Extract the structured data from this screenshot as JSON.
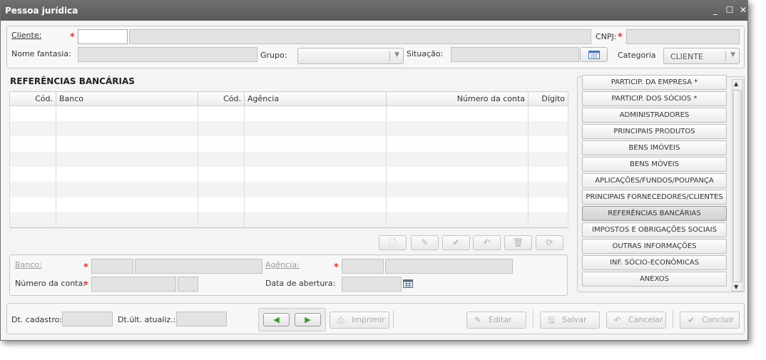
{
  "window": {
    "title": "Pessoa jurídica",
    "minimize": "_",
    "maximize": "☐",
    "close": "✕"
  },
  "header": {
    "cliente_label": "Cliente:",
    "cnpj_label": "CNPJ:",
    "nome_fantasia_label": "Nome fantasia:",
    "grupo_label": "Grupo:",
    "situacao_label": "Situação:",
    "categoria_label": "Categoria",
    "categoria_value": "CLIENTE",
    "required_mark": "*"
  },
  "section": {
    "title": "REFERÊNCIAS BANCÁRIAS",
    "columns": [
      "Cód.",
      "Banco",
      "Cód.",
      "Agência",
      "Número da conta",
      "Dígito"
    ]
  },
  "detail": {
    "banco_label": "Banco:",
    "agencia_label": "Agência:",
    "numero_conta_label": "Número da conta:",
    "data_abertura_label": "Data de abertura:"
  },
  "side_menu": [
    "PARTICIP. DA EMPRESA *",
    "PARTICIP. DOS SÓCIOS *",
    "ADMINISTRADORES",
    "PRINCIPAIS PRODUTOS",
    "BENS IMÓVEIS",
    "BENS MÓVEIS",
    "APLICAÇÕES/FUNDOS/POUPANÇA",
    "PRINCIPAIS FORNECEDORES/CLIENTES",
    "REFERÊNCIAS BANCÁRIAS",
    "IMPOSTOS E OBRIGAÇÕES SOCIAIS",
    "OUTRAS INFORMAÇÕES",
    "INF. SÓCIO-ECONÔMICAS",
    "ANEXOS"
  ],
  "side_menu_active": "REFERÊNCIAS BANCÁRIAS",
  "footer": {
    "dt_cadastro_label": "Dt. cadastro:",
    "dt_ult_atualiz_label": "Dt.últ. atualiz.:",
    "imprimir": "Imprimir",
    "editar": "Editar",
    "salvar": "Salvar",
    "cancelar": "Cancelar",
    "concluir": "Concluir"
  },
  "colors": {
    "titlebar": "#666666",
    "required": "#dd3333",
    "nav_arrow": "#3b9a2f"
  }
}
